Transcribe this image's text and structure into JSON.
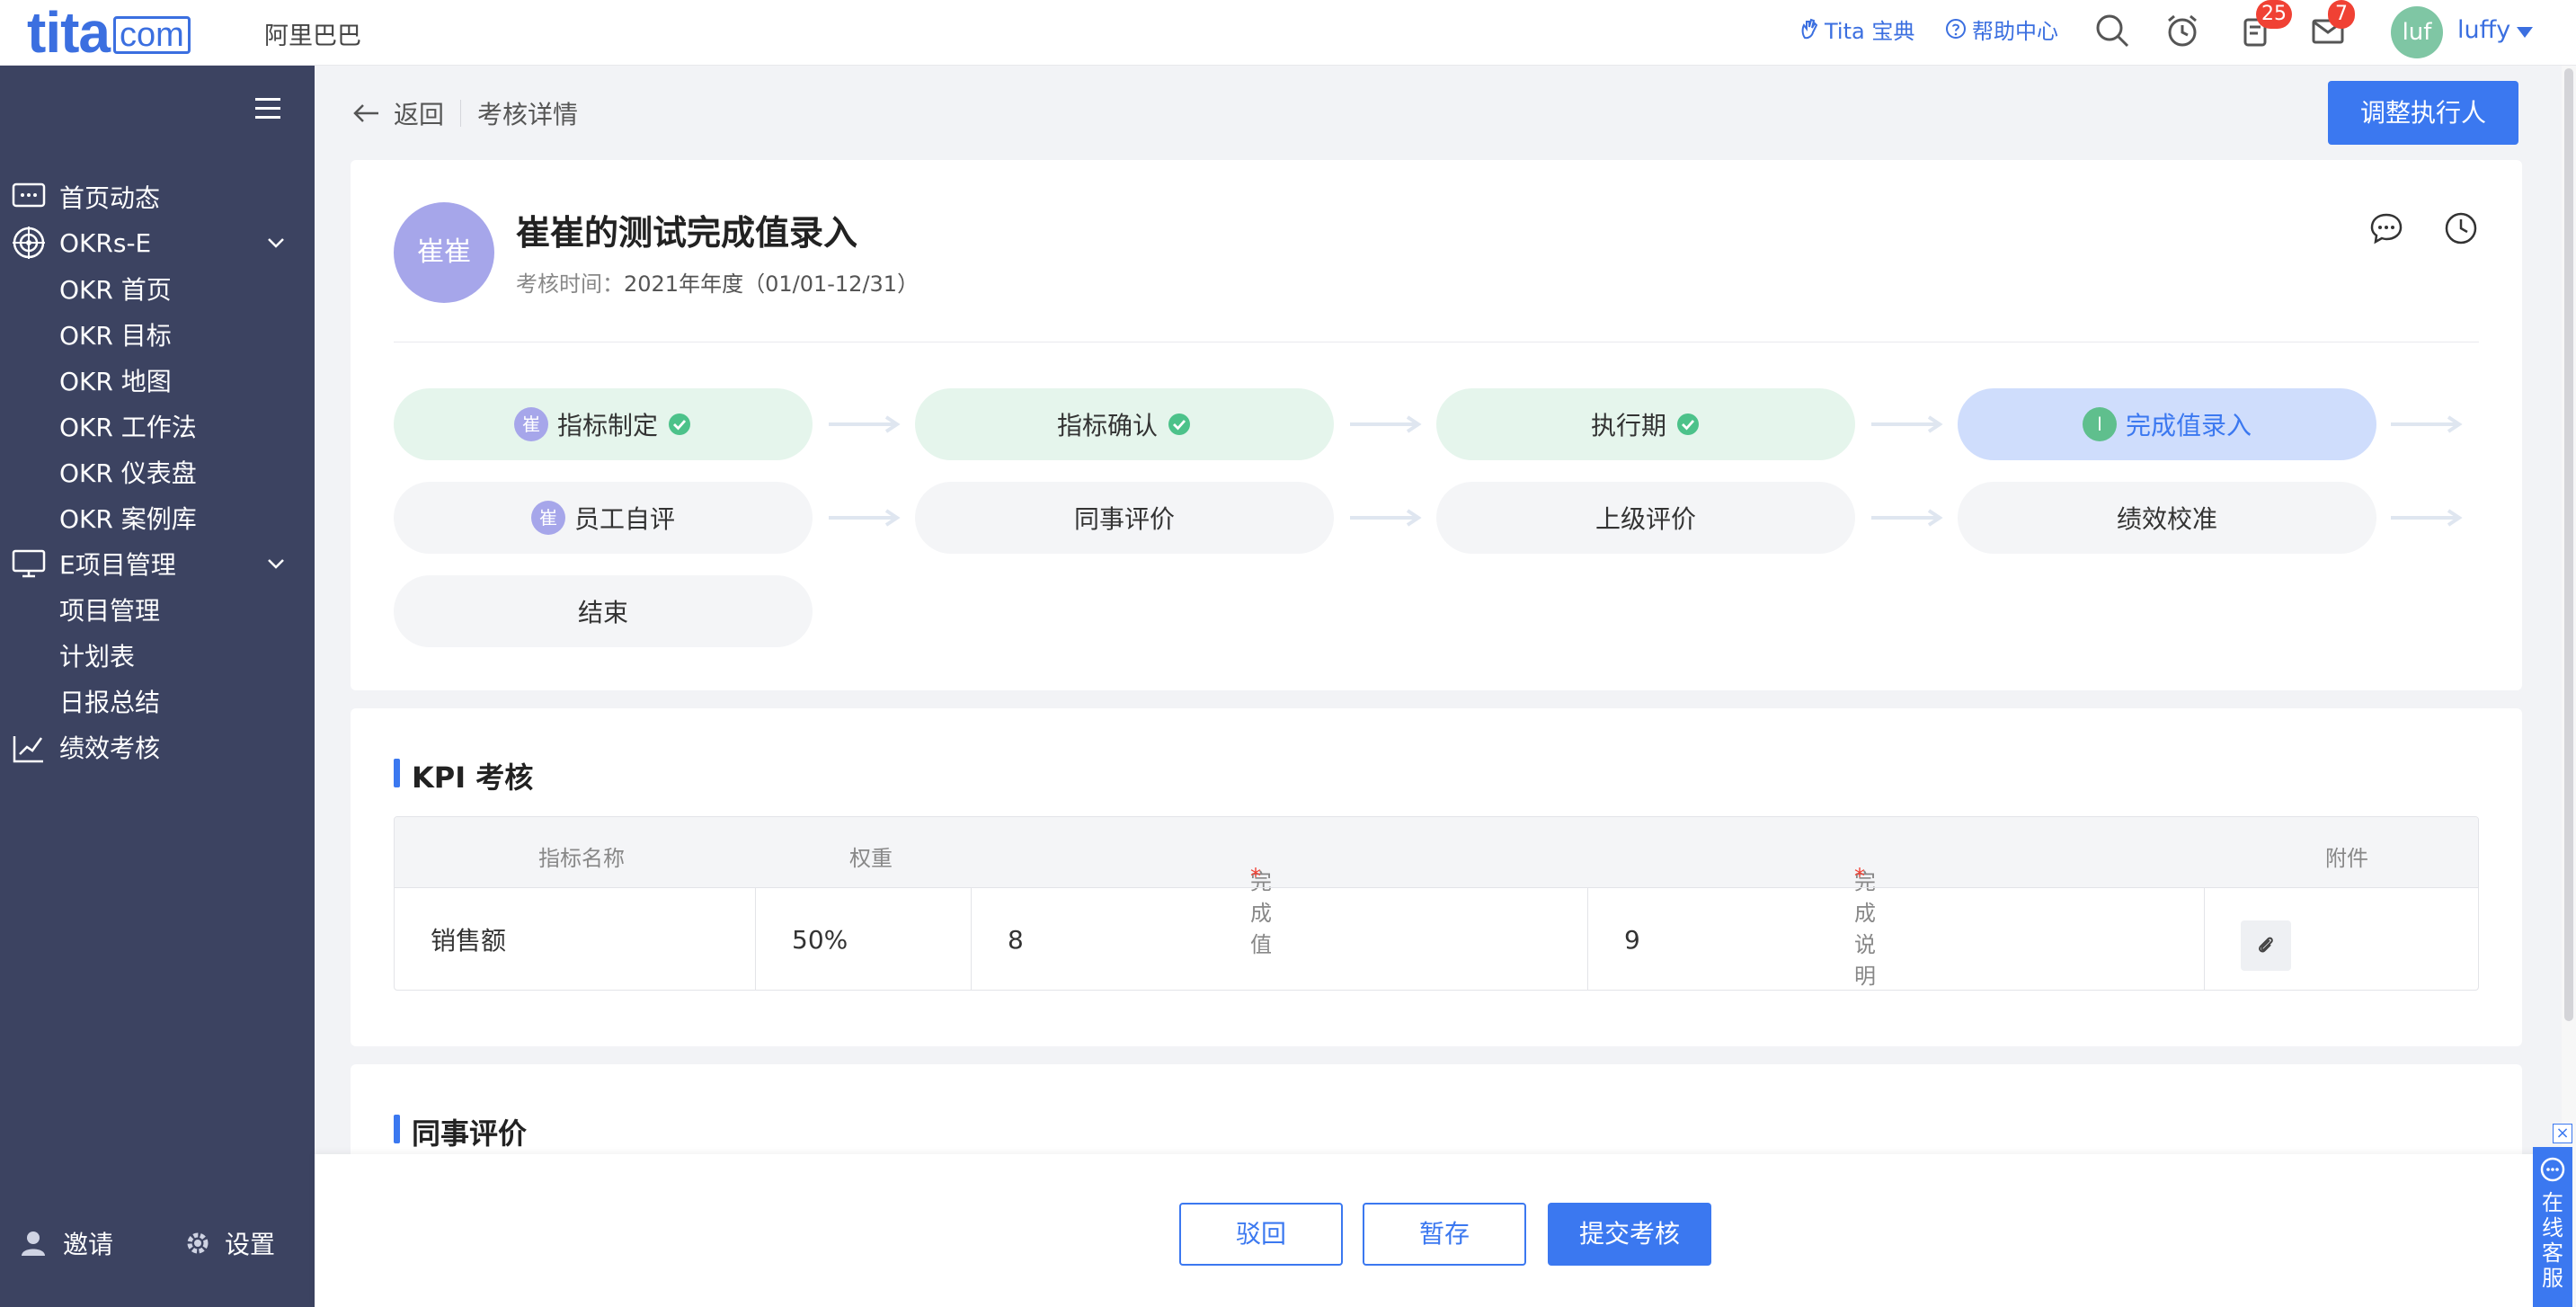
{
  "topbar": {
    "logo_main": "tita",
    "logo_com": "com",
    "org_name": "阿里巴巴",
    "tita_dict": "Tita 宝典",
    "help_center": "帮助中心",
    "notify_badge": "25",
    "mail_badge": "7",
    "avatar_text": "luf",
    "username": "luffy"
  },
  "sidebar": {
    "items": [
      {
        "label": "首页动态"
      },
      {
        "label": "OKRs-E"
      },
      {
        "label": "OKR 首页"
      },
      {
        "label": "OKR 目标"
      },
      {
        "label": "OKR 地图"
      },
      {
        "label": "OKR 工作法"
      },
      {
        "label": "OKR 仪表盘"
      },
      {
        "label": "OKR 案例库"
      },
      {
        "label": "E项目管理"
      },
      {
        "label": "项目管理"
      },
      {
        "label": "计划表"
      },
      {
        "label": "日报总结"
      },
      {
        "label": "绩效考核"
      }
    ],
    "invite": "邀请",
    "settings": "设置"
  },
  "breadcrumb": {
    "back": "返回",
    "current": "考核详情"
  },
  "adjust_button": "调整执行人",
  "header": {
    "avatar_text": "崔崔",
    "title": "崔崔的测试完成值录入",
    "time_label": "考核时间：",
    "time_value": "2021年年度（01/01-12/31）"
  },
  "steps": [
    {
      "label": "指标制定",
      "avatar": "崔",
      "status": "done"
    },
    {
      "label": "指标确认",
      "status": "done"
    },
    {
      "label": "执行期",
      "status": "done"
    },
    {
      "label": "完成值录入",
      "avatar": "l",
      "status": "current"
    },
    {
      "label": "员工自评",
      "avatar": "崔",
      "status": "todo"
    },
    {
      "label": "同事评价",
      "status": "todo"
    },
    {
      "label": "上级评价",
      "status": "todo"
    },
    {
      "label": "绩效校准",
      "status": "todo"
    },
    {
      "label": "结束",
      "status": "todo"
    }
  ],
  "kpi": {
    "section_title": "KPI 考核",
    "headers": {
      "name": "指标名称",
      "weight": "权重",
      "value": "完成值",
      "note": "完成说明",
      "attach": "附件",
      "required_mark": "*"
    },
    "rows": [
      {
        "name": "销售额",
        "weight": "50%",
        "value": "8",
        "note": "9"
      }
    ]
  },
  "peer_section_title": "同事评价",
  "footer": {
    "reject": "驳回",
    "save": "暂存",
    "submit": "提交考核"
  },
  "chat_widget": "在线客服",
  "colors": {
    "primary": "#3b78f0",
    "sidebar_bg": "#3c4361",
    "done_bg": "#e5f5ec",
    "current_bg": "#cfddfc",
    "check_green": "#4cc28a",
    "badge_red": "#f04134"
  }
}
